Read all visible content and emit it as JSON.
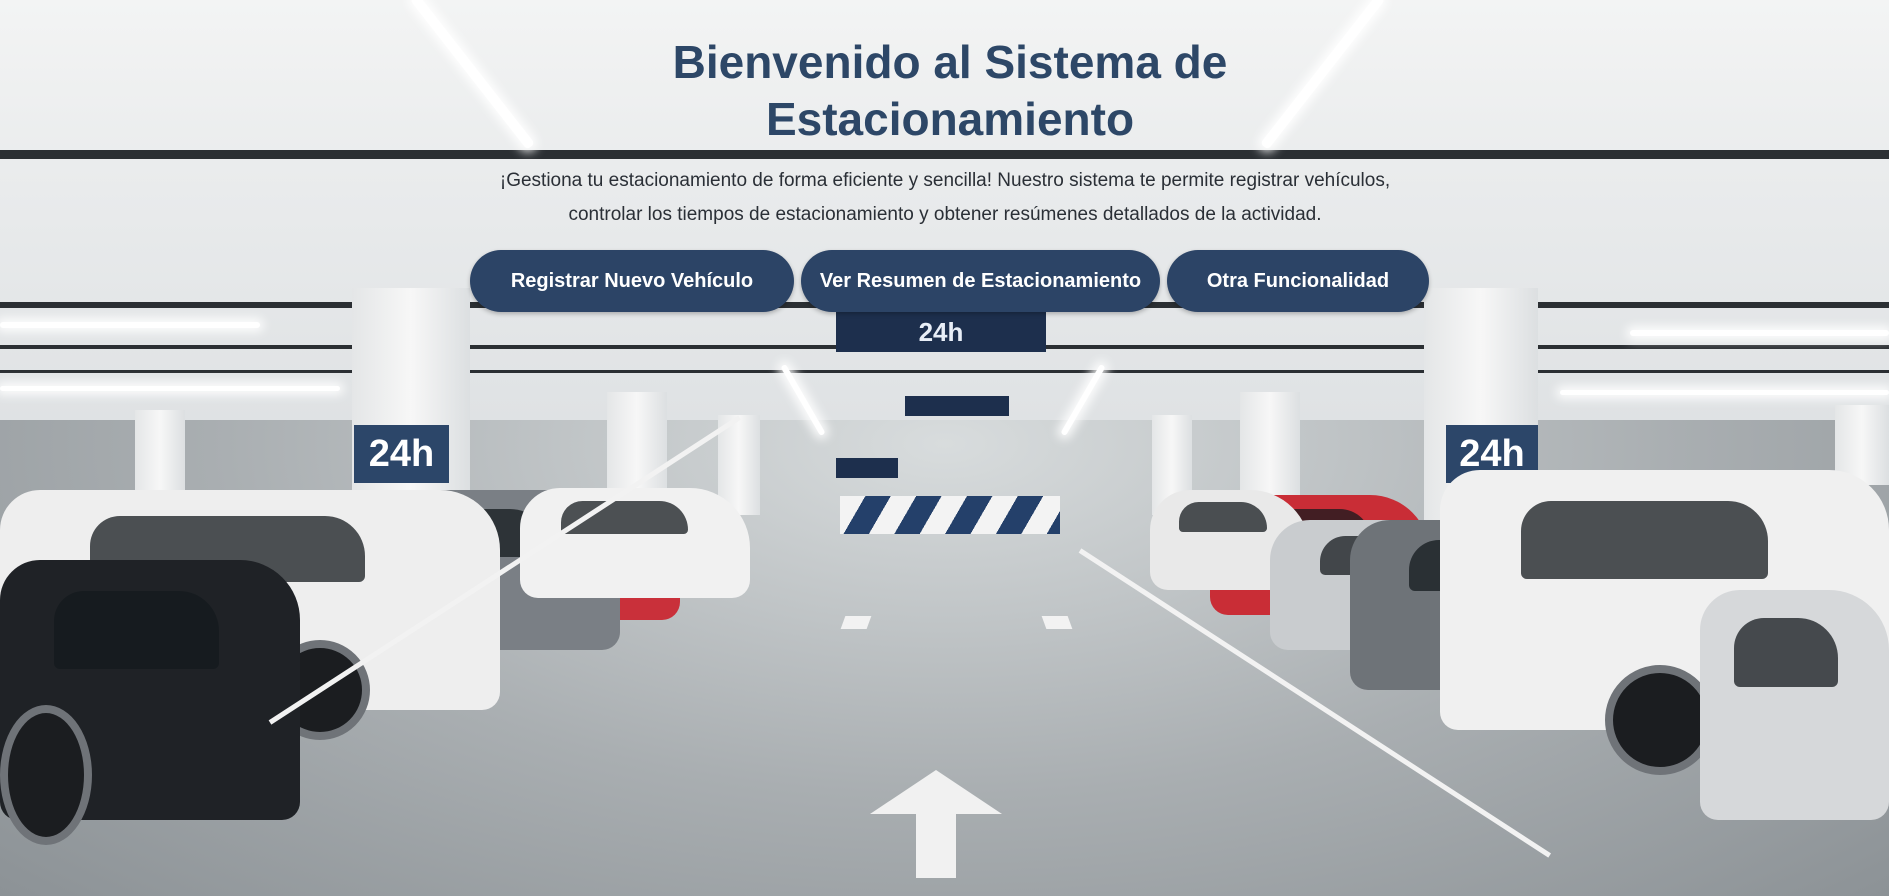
{
  "hero": {
    "title": "Bienvenido al Sistema de Estacionamiento",
    "subtitle": "¡Gestiona tu estacionamiento de forma eficiente y sencilla! Nuestro sistema te permite registrar vehículos, controlar los tiempos de estacionamiento y obtener resúmenes detallados de la actividad."
  },
  "actions": {
    "register_label": "Registrar Nuevo Vehículo",
    "summary_label": "Ver Resumen de Estacionamiento",
    "other_label": "Otra Funcionalidad"
  },
  "background": {
    "pillar_sign": "24h",
    "hanging_sign": "24h"
  },
  "colors": {
    "button_bg": "#2c4466",
    "title": "#2d4767",
    "button_text": "#ffffff"
  }
}
